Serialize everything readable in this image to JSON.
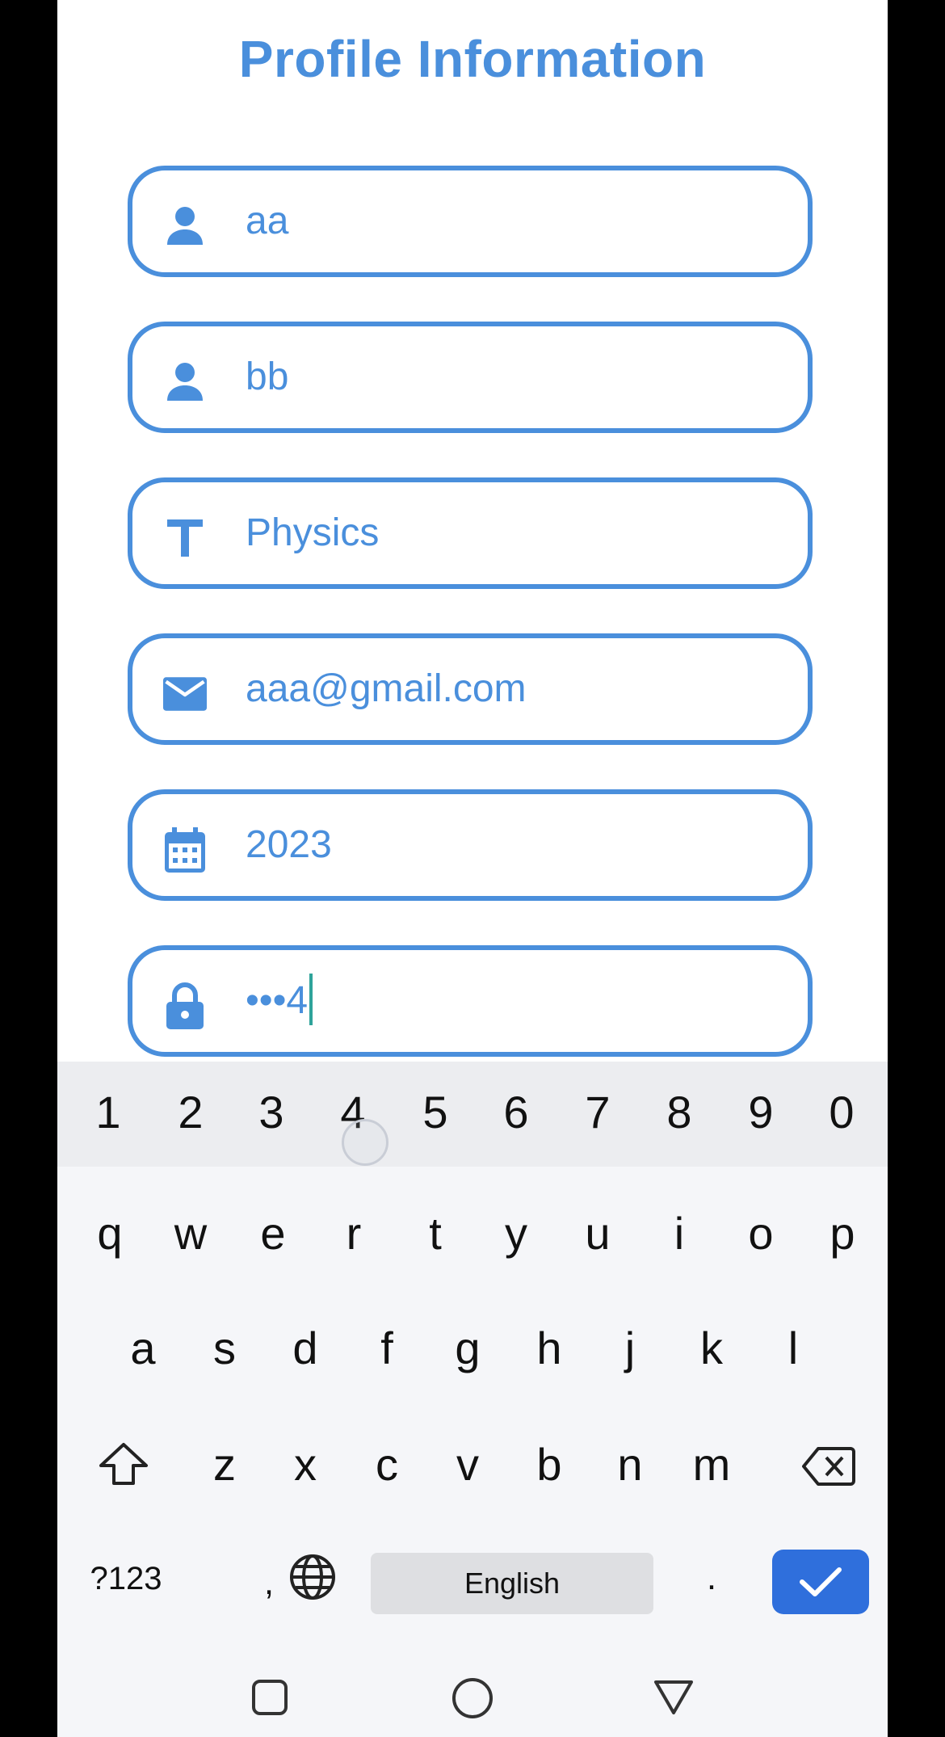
{
  "screen": {
    "title": "Profile Information"
  },
  "fields": [
    {
      "name": "first-name-field",
      "icon": "person-icon",
      "value": "aa"
    },
    {
      "name": "last-name-field",
      "icon": "person-icon",
      "value": "bb"
    },
    {
      "name": "subject-field",
      "icon": "text-icon",
      "value": "Physics"
    },
    {
      "name": "email-field",
      "icon": "mail-icon",
      "value": "aaa@gmail.com"
    },
    {
      "name": "year-field",
      "icon": "calendar-icon",
      "value": "2023"
    },
    {
      "name": "password-field",
      "icon": "lock-icon",
      "value": "•••4"
    }
  ],
  "keyboard": {
    "number_row": [
      "1",
      "2",
      "3",
      "4",
      "5",
      "6",
      "7",
      "8",
      "9",
      "0"
    ],
    "row1": [
      "q",
      "w",
      "e",
      "r",
      "t",
      "y",
      "u",
      "i",
      "o",
      "p"
    ],
    "row2": [
      "a",
      "s",
      "d",
      "f",
      "g",
      "h",
      "j",
      "k",
      "l"
    ],
    "row3": [
      "z",
      "x",
      "c",
      "v",
      "b",
      "n",
      "m"
    ],
    "symbols_label": "?123",
    "comma_label": ",",
    "space_label": "English",
    "period_label": ".",
    "shift_icon": "shift-icon",
    "backspace_icon": "backspace-icon",
    "globe_icon": "globe-icon",
    "enter_icon": "checkmark-icon"
  },
  "colors": {
    "accent": "#4a8fdc",
    "enter_key": "#2f6fdc",
    "caret": "#2fa39a"
  },
  "nav": {
    "recents_icon": "square-icon",
    "home_icon": "circle-icon",
    "back_icon": "triangle-icon"
  }
}
